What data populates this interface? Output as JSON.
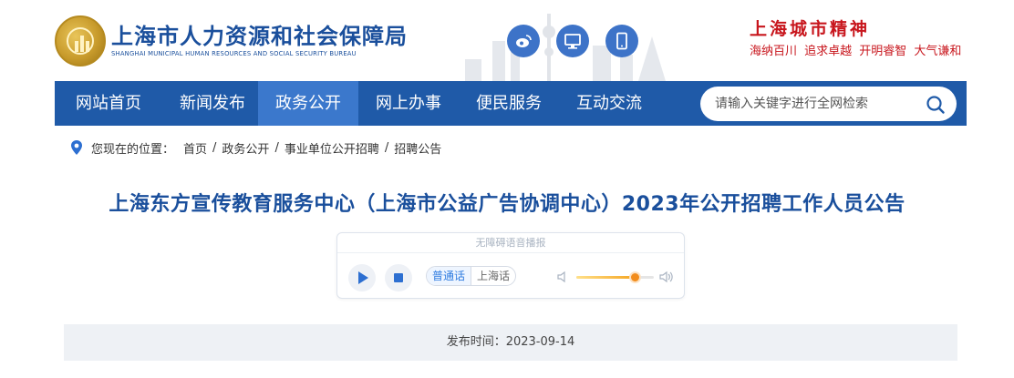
{
  "header": {
    "site_title": "上海市人力资源和社会保障局",
    "site_subtitle": "SHANGHAI MUNICIPAL HUMAN RESOURCES AND SOCIAL SECURITY BUREAU",
    "spirit_title": "上海城市精神",
    "spirit_slogan": "海纳百川  追求卓越  开明睿智  大气谦和",
    "icons": [
      "weibo-icon",
      "desktop-icon",
      "mobile-icon"
    ]
  },
  "nav": {
    "items": [
      {
        "label": "网站首页",
        "active": false
      },
      {
        "label": "新闻发布",
        "active": false
      },
      {
        "label": "政务公开",
        "active": true
      },
      {
        "label": "网上办事",
        "active": false
      },
      {
        "label": "便民服务",
        "active": false
      },
      {
        "label": "互动交流",
        "active": false
      }
    ],
    "search_placeholder": "请输入关键字进行全网检索"
  },
  "breadcrumb": {
    "label": "您现在的位置：",
    "items": [
      "首页",
      "政务公开",
      "事业单位公开招聘",
      "招聘公告"
    ]
  },
  "article": {
    "title": "上海东方宣传教育服务中心（上海市公益广告协调中心）2023年公开招聘工作人员公告",
    "publish_text": "发布时间：2023-09-14"
  },
  "player": {
    "title": "无障碍语音播报",
    "dialect_on": "普通话",
    "dialect_off": "上海话",
    "volume_level": 0.75
  },
  "colors": {
    "brand_blue": "#1a4f9c",
    "nav_bg": "#1f5aa8",
    "nav_active": "#3b78cc",
    "accent_red": "#c8161d"
  }
}
